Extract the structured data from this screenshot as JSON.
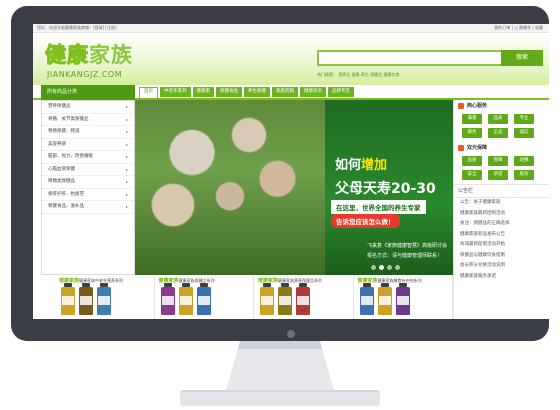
{
  "topbar": {
    "welcome": "您好，欢迎光临健康家族商城！[登录] [注册]",
    "links": "我的订单 | 🛒购物车 | 收藏"
  },
  "header": {
    "logo_cn_1": "健康",
    "logo_cn_2": "家族",
    "logo_en": "JIANKANGJZ.COM",
    "search_placeholder": "",
    "search_button": "搜索",
    "hot_words": "热门搜索：  营养品  健康  养生  保健品  健康饮食"
  },
  "categories": {
    "title": "所有商品分类",
    "items": [
      {
        "label": "营养保健品",
        "arrow": "▸"
      },
      {
        "label": "骨骼、关节类保健品",
        "arrow": "▸"
      },
      {
        "label": "胃肠保健、肠道",
        "arrow": "▸"
      },
      {
        "label": "美容养颜",
        "arrow": "▸"
      },
      {
        "label": "脑部、视力、改善睡眠",
        "arrow": "▸"
      },
      {
        "label": "心脑血管保健",
        "arrow": "▸"
      },
      {
        "label": "降糖类保健品",
        "arrow": "▸"
      },
      {
        "label": "保肝护肝、抗疲劳",
        "arrow": "▸"
      },
      {
        "label": "保健食品、滋补品",
        "arrow": "▸"
      }
    ]
  },
  "nav": {
    "items": [
      "首页",
      "中老年系列",
      "健康家",
      "保健食品",
      "养生保健",
      "家庭药箱",
      "健康资讯",
      "品牌专区"
    ]
  },
  "banner": {
    "line1_a": "如何",
    "line1_b": "增加",
    "line2": "父母天寿20-30年?",
    "tag1": "在这里，世界全国的养生专家",
    "tag2": "告诉您应该怎么做！",
    "sub1": "飞来复《家族健康智慧》高级研讨会",
    "sub2": "报名方式：请与健康管理师联系！"
  },
  "right": {
    "sec1_title": "两心服务",
    "sec1_buttons": [
      "满意",
      "品质",
      "专业",
      "服务",
      "正品",
      "诚信"
    ],
    "sec2_title": "双元保障",
    "sec2_buttons": [
      "品质",
      "保障",
      "退换",
      "安全",
      "承诺",
      "服务"
    ],
    "news_title": "公告栏",
    "news": [
      "公告：关于健康家族",
      "健康家族最新团购活动",
      "关注：保健品的正确选择",
      "健康家族新品发布公告",
      "商城最新促销活动开始",
      "保健品与健康饮食指南",
      "会员积分兑换活动说明",
      "健康家族服务承诺"
    ]
  },
  "products": [
    {
      "logo": "健康家族",
      "caption": "健康家族中老年营养系列"
    },
    {
      "logo": "健康家族",
      "caption": "健康家族保健品系列"
    },
    {
      "logo": "健康家族",
      "caption": "健康家族营养保健品系列"
    },
    {
      "logo": "健康家族",
      "caption": "健康家族膳食补充剂系列"
    }
  ],
  "colors": {
    "brand_green": "#63aa18",
    "dark_green": "#4f9a12",
    "monitor": "#3b3d44",
    "accent_red": "#e83a2a",
    "accent_yellow": "#ffe400"
  }
}
